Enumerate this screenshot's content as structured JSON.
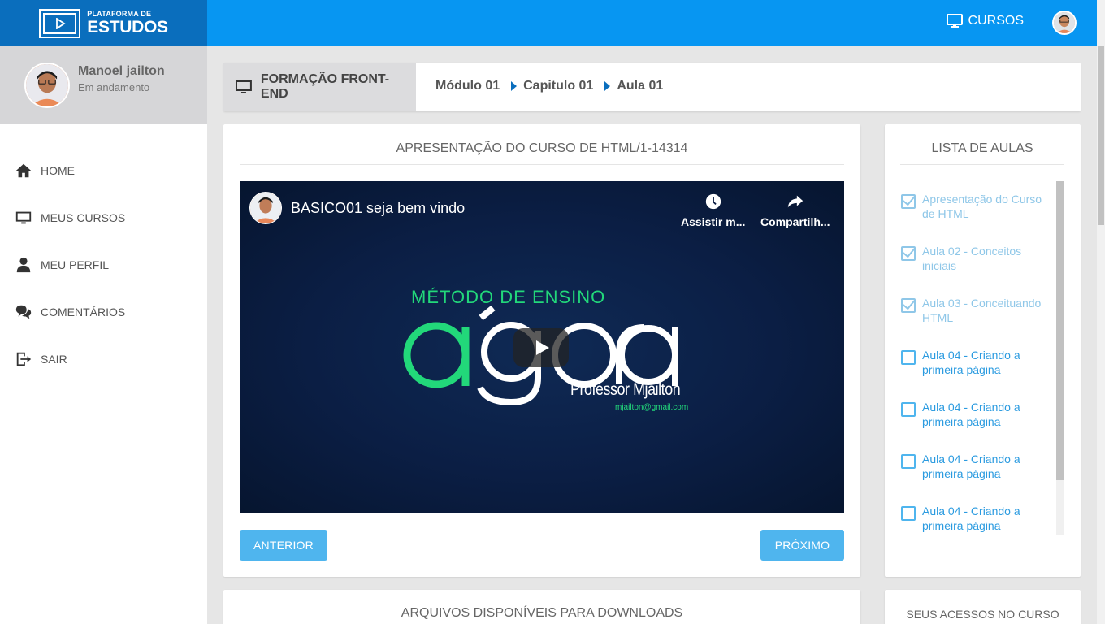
{
  "brand": {
    "small": "PLATAFORMA DE",
    "big": "ESTUDOS"
  },
  "topbar": {
    "courses_label": "CURSOS"
  },
  "profile": {
    "name": "Manoel jailton",
    "status": "Em andamento"
  },
  "nav": [
    {
      "label": "HOME",
      "icon": "home-icon"
    },
    {
      "label": "MEUS CURSOS",
      "icon": "monitor-icon"
    },
    {
      "label": "MEU PERFIL",
      "icon": "user-icon"
    },
    {
      "label": "COMENTÁRIOS",
      "icon": "comments-icon"
    },
    {
      "label": "SAIR",
      "icon": "logout-icon"
    }
  ],
  "breadcrumb": {
    "course": "FORMAÇÃO FRONT-END",
    "module": "Módulo 01",
    "chapter": "Capitulo 01",
    "lesson": "Aula 01"
  },
  "main": {
    "title": "APRESENTAÇÃO DO CURSO DE HTML/1-14314",
    "video": {
      "title": "BASICO01 seja bem vindo",
      "watch_later": "Assistir m...",
      "share": "Compartilh...",
      "tagline": "MÉTODO DE ENSINO",
      "brand": "agora",
      "professor": "Professor Mjailton",
      "email": "mjailton@gmail.com"
    },
    "prev_label": "ANTERIOR",
    "next_label": "PRÓXIMO"
  },
  "lessons": {
    "title": "LISTA DE AULAS",
    "items": [
      {
        "label": "Apresentação do Curso de HTML",
        "done": true
      },
      {
        "label": "Aula 02 - Conceitos iniciais",
        "done": true
      },
      {
        "label": "Aula 03 - Conceituando HTML",
        "done": true
      },
      {
        "label": "Aula 04 - Criando a primeira página",
        "done": false
      },
      {
        "label": "Aula 04 - Criando a primeira página",
        "done": false
      },
      {
        "label": "Aula 04 - Criando a primeira página",
        "done": false
      },
      {
        "label": "Aula 04 - Criando a primeira página",
        "done": false
      }
    ]
  },
  "downloads": {
    "title": "ARQUIVOS DISPONÍVEIS PARA DOWNLOADS"
  },
  "access": {
    "title": "SEUS ACESSOS NO CURSO"
  },
  "colors": {
    "brand_dark": "#0a6ebd",
    "brand": "#0796f2",
    "button": "#4fb5ee",
    "accent_green": "#22d87a"
  }
}
